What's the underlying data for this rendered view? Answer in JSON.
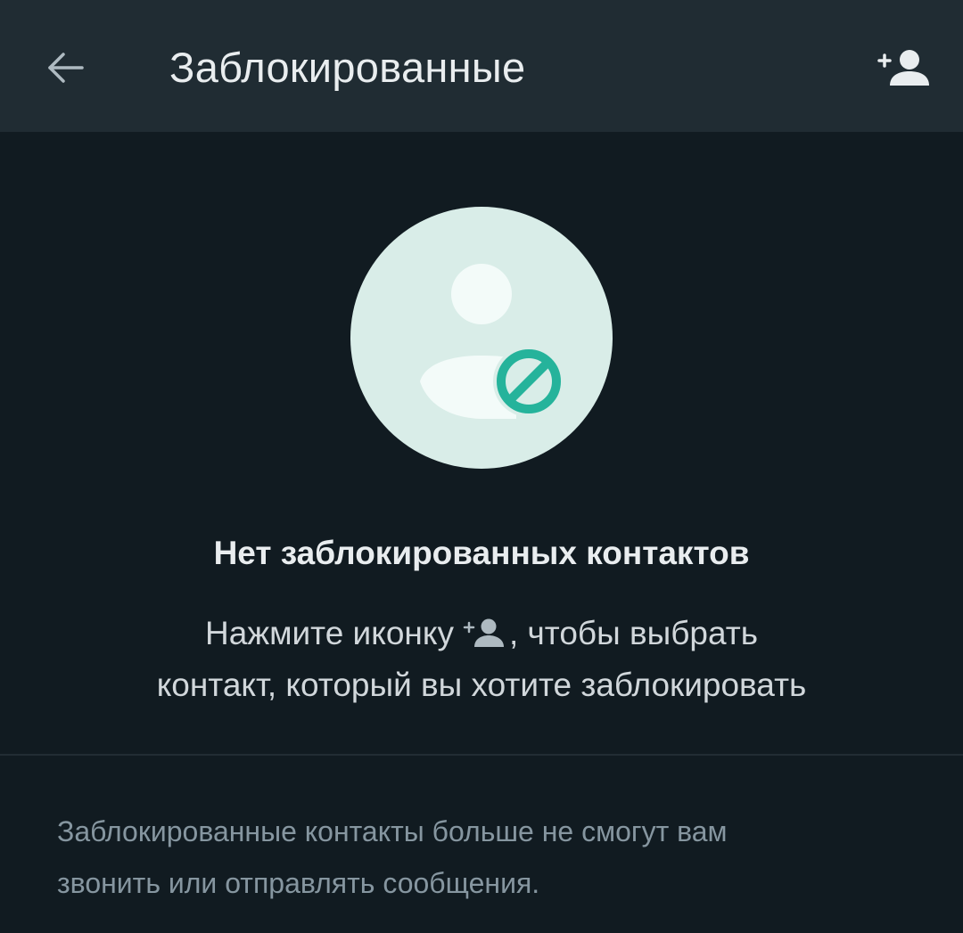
{
  "header": {
    "title": "Заблокированные",
    "back_icon": "arrow-back-icon",
    "add_icon": "add-contact-icon"
  },
  "empty_state": {
    "illustration_icon": "blocked-contact-icon",
    "title": "Нет заблокированных контактов",
    "desc_before": "Нажмите иконку",
    "desc_inline_icon": "add-contact-icon",
    "desc_after": ", чтобы выбрать",
    "desc_line2": "контакт, который вы хотите заблокировать"
  },
  "footer": {
    "note_line1": "Заблокированные контакты больше не смогут вам",
    "note_line2": "звонить или отправлять сообщения."
  },
  "colors": {
    "background": "#111b21",
    "header": "#202c33",
    "accent": "#25b39b",
    "illustration_bg": "#d9ede8"
  }
}
